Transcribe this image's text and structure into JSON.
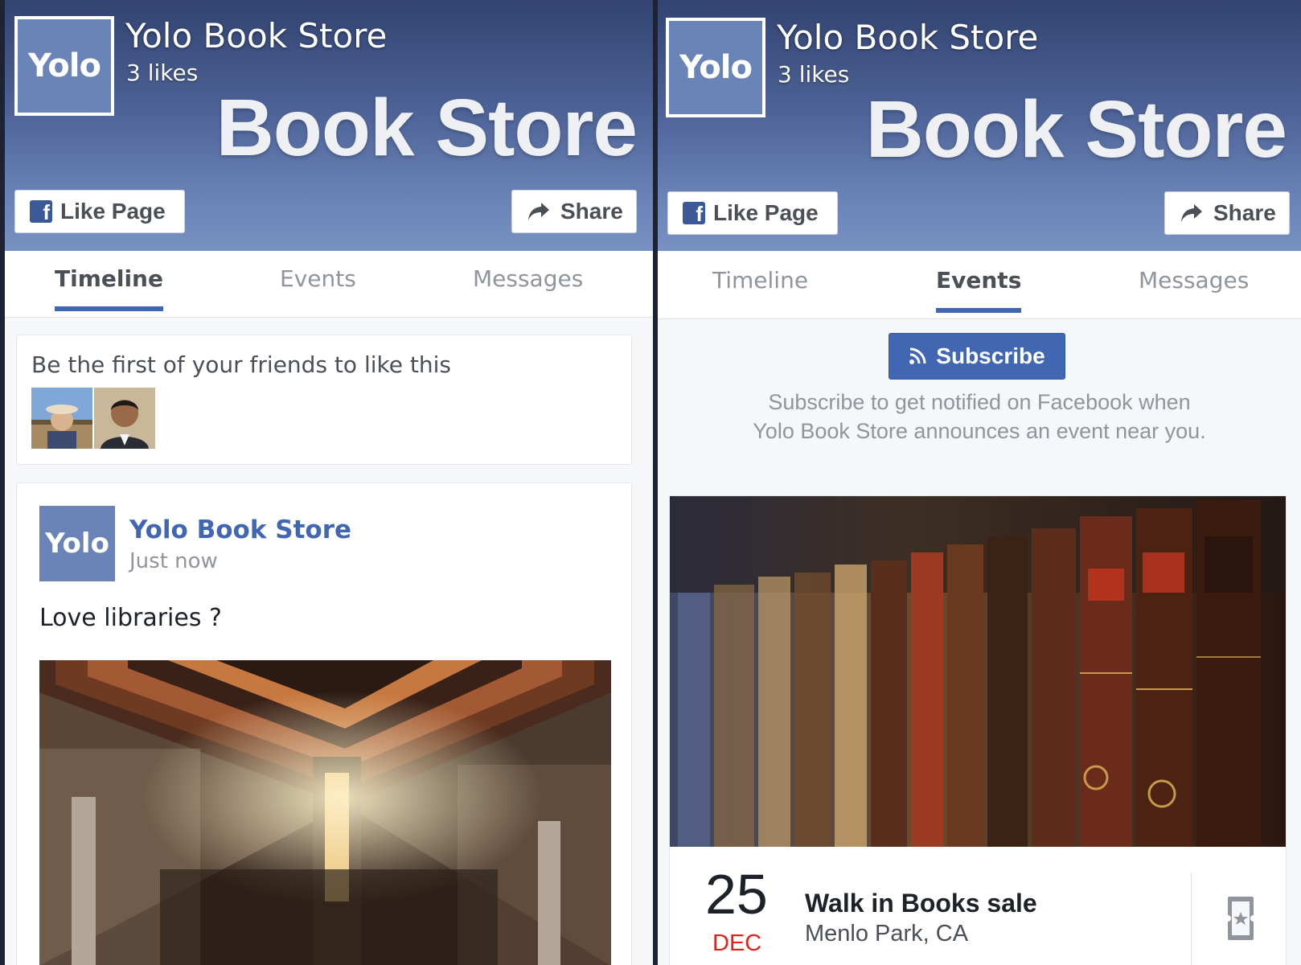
{
  "page": {
    "name": "Yolo Book Store",
    "likes": "3 likes",
    "logo_text": "Yolo",
    "cover_text": "Book Store",
    "like_button_label": "Like Page",
    "share_button_label": "Share"
  },
  "tabs": [
    "Timeline",
    "Events",
    "Messages"
  ],
  "left_view": {
    "active_tab": "Timeline",
    "friends_prompt": "Be the first of your friends to like this",
    "post": {
      "author": "Yolo Book Store",
      "time": "Just now",
      "text": "Love libraries ?"
    }
  },
  "right_view": {
    "active_tab": "Events",
    "subscribe_label": "Subscribe",
    "subscribe_desc_line1": "Subscribe to get notified on Facebook when",
    "subscribe_desc_line2": "Yolo Book Store announces an event near you.",
    "event": {
      "day": "25",
      "month": "DEC",
      "title": "Walk in Books sale",
      "location": "Menlo Park, CA"
    }
  },
  "icons": {
    "facebook": "facebook-f-icon",
    "share": "share-arrow-icon",
    "rss": "rss-icon",
    "ticket": "ticket-icon"
  },
  "colors": {
    "accent": "#4267b2",
    "cover_top": "#324371",
    "cover_bottom": "#7891c2",
    "logo": "#6b84b8",
    "event_month": "#e0241b"
  }
}
